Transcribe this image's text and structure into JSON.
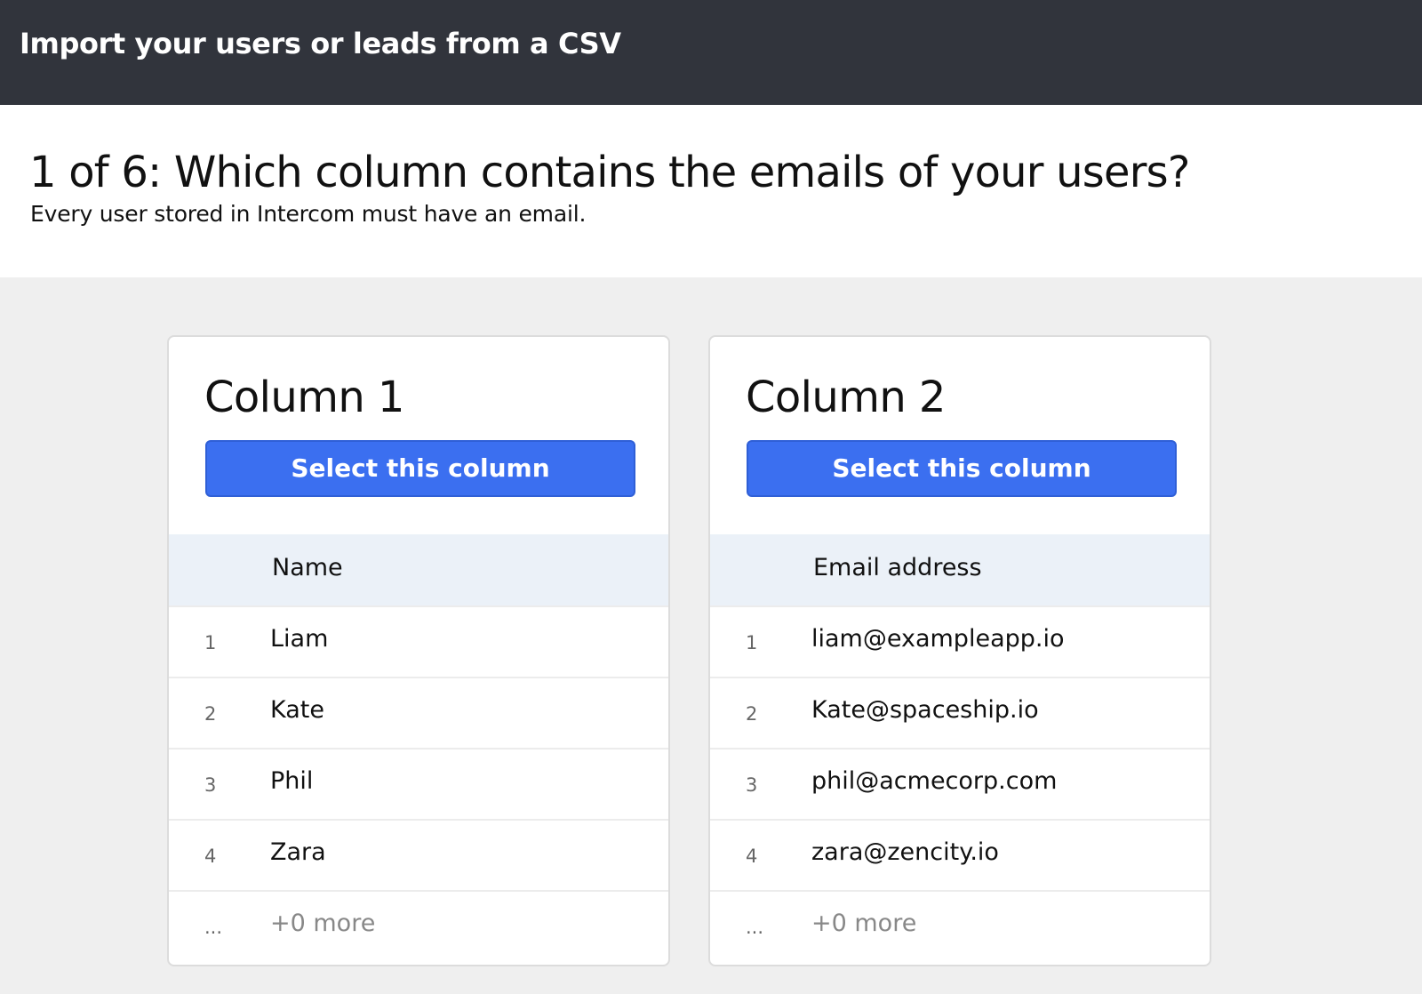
{
  "topbar": {
    "title": "Import your users or leads from a CSV"
  },
  "step": {
    "title": "1 of 6: Which column contains the emails of your users?",
    "subtitle": "Every user stored in Intercom must have an email."
  },
  "columns": [
    {
      "title": "Column 1",
      "select_label": "Select this column",
      "header": "Name",
      "rows": [
        {
          "num": "1",
          "value": "Liam"
        },
        {
          "num": "2",
          "value": "Kate"
        },
        {
          "num": "3",
          "value": "Phil"
        },
        {
          "num": "4",
          "value": "Zara"
        }
      ],
      "more": {
        "num": "...",
        "value": "+0 more"
      }
    },
    {
      "title": "Column 2",
      "select_label": "Select this column",
      "header": "Email address",
      "rows": [
        {
          "num": "1",
          "value": "liam@exampleapp.io"
        },
        {
          "num": "2",
          "value": "Kate@spaceship.io"
        },
        {
          "num": "3",
          "value": "phil@acmecorp.com"
        },
        {
          "num": "4",
          "value": "zara@zencity.io"
        }
      ],
      "more": {
        "num": "...",
        "value": "+0 more"
      }
    }
  ],
  "colors": {
    "topbar_bg": "#31343c",
    "button_bg": "#3b6ff0",
    "header_row_bg": "#ebf1f8",
    "page_bg": "#efefef"
  }
}
